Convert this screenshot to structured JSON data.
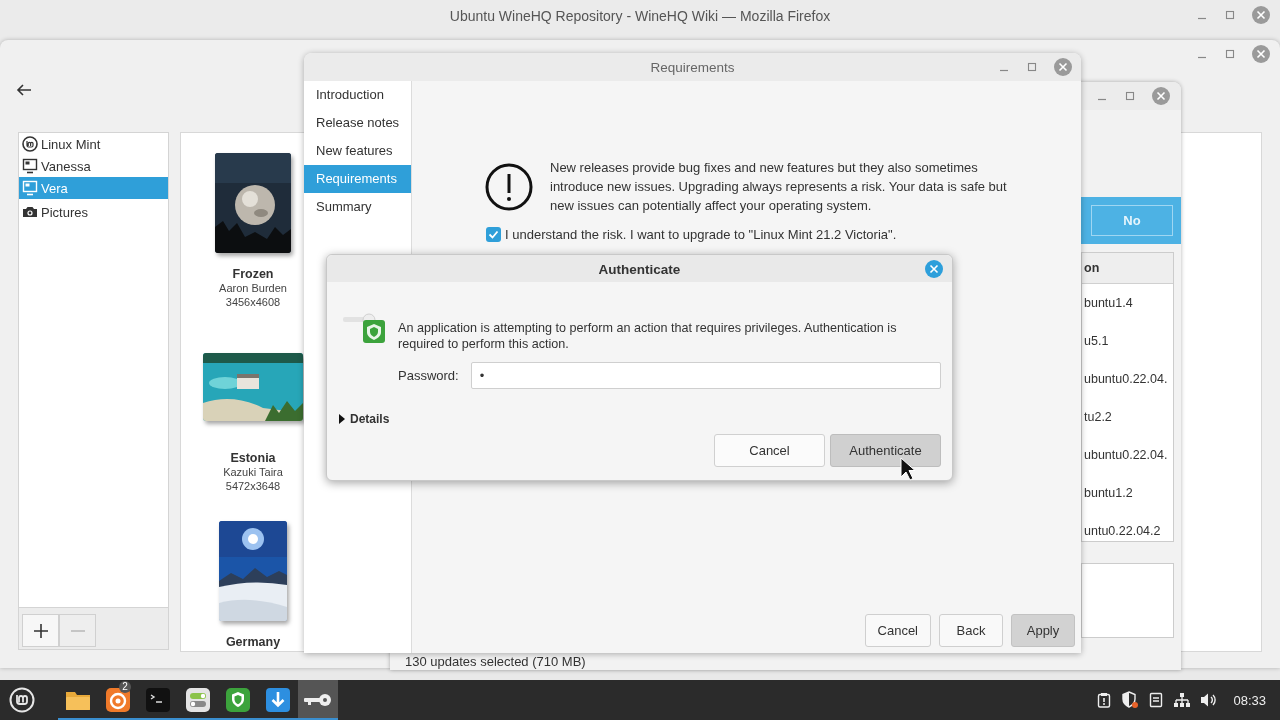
{
  "firefox_window": {
    "title": "Ubuntu WineHQ Repository - WineHQ Wiki — Mozilla Firefox"
  },
  "system_settings": {
    "sidebar": [
      {
        "label": "Linux Mint",
        "kind": "logo",
        "selected": false
      },
      {
        "label": "Vanessa",
        "kind": "monitor",
        "selected": false
      },
      {
        "label": "Vera",
        "kind": "monitor",
        "selected": true
      },
      {
        "label": "Pictures",
        "kind": "camera",
        "selected": false
      }
    ],
    "list_buttons": [
      {
        "kind": "add",
        "disabled": false
      },
      {
        "kind": "remove",
        "disabled": true
      }
    ],
    "wallpapers": [
      {
        "kind": "picture",
        "name": "Frozen",
        "author": "Aaron Burden",
        "size": "3456x4608"
      },
      {
        "kind": "picture",
        "name": "Estonia",
        "author": "Kazuki Taira",
        "size": "5472x3648"
      },
      {
        "kind": "picture",
        "name": "Germany"
      }
    ]
  },
  "update_manager": {
    "button": "No",
    "column_header": "on",
    "versions": [
      "buntu1.4",
      "u5.1",
      "ubuntu0.22.04.",
      "tu2.2",
      "ubuntu0.22.04.",
      "buntu1.2",
      "untu0.22.04.2"
    ],
    "status": "130 updates selected (710 MB)"
  },
  "requirements": {
    "title": "Requirements",
    "steps": [
      {
        "label": "Introduction",
        "selected": false
      },
      {
        "label": "Release notes",
        "selected": false
      },
      {
        "label": "New features",
        "selected": false
      },
      {
        "label": "Requirements",
        "selected": true
      },
      {
        "label": "Summary",
        "selected": false
      }
    ],
    "message": "New releases provide bug fixes and new features but they also sometimes introduce new issues. Upgrading always represents a risk. Your data is safe but new issues can potentially affect your operating system.",
    "confirm": {
      "label": "I understand the risk. I want to upgrade to \"Linux Mint 21.2 Victoria\".",
      "checked": true
    },
    "buttons": [
      {
        "label": "Cancel",
        "default": false
      },
      {
        "label": "Back",
        "default": false
      },
      {
        "label": "Apply",
        "default": true
      }
    ]
  },
  "authenticate": {
    "title": "Authenticate",
    "message": "An application is attempting to perform an action that requires privileges. Authentication is required to perform this action.",
    "password": {
      "label": "Password:",
      "value": "•"
    },
    "details": {
      "label": "Details",
      "expanded": false
    },
    "buttons": [
      {
        "label": "Cancel",
        "default": false
      },
      {
        "label": "Authenticate",
        "default": true
      }
    ]
  },
  "taskbar": {
    "apps": [
      {
        "kind": "folder",
        "active": false
      },
      {
        "kind": "firefox",
        "active": false,
        "badge": "2"
      },
      {
        "kind": "terminal",
        "active": false
      },
      {
        "kind": "toggles",
        "active": false
      },
      {
        "kind": "shield",
        "active": false
      },
      {
        "kind": "download",
        "active": false
      },
      {
        "kind": "key",
        "active": true
      }
    ],
    "tray": [
      {
        "kind": "clipboard"
      },
      {
        "kind": "shield"
      },
      {
        "kind": "document"
      },
      {
        "kind": "network"
      },
      {
        "kind": "volume"
      }
    ],
    "clock": "08:33"
  }
}
